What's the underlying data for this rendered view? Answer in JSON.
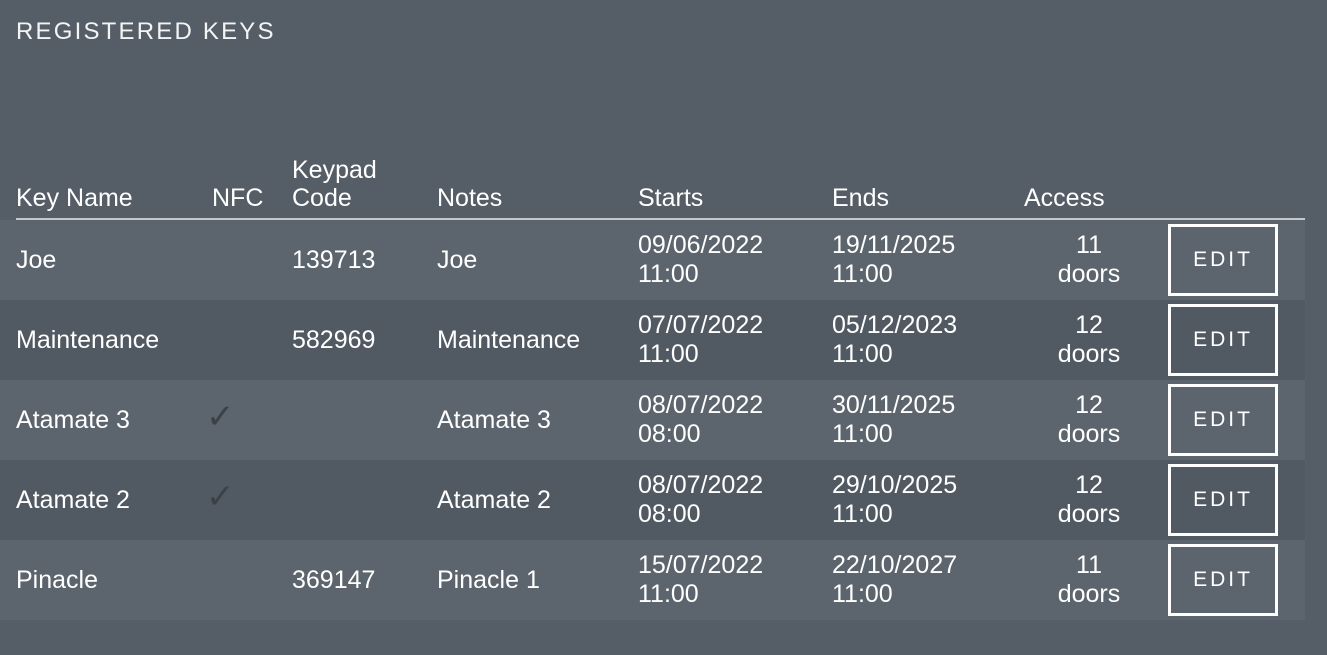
{
  "page": {
    "title": "REGISTERED KEYS",
    "background_color": "#555e66",
    "text_color": "#ffffff",
    "row_odd_color": "#5c656d",
    "row_even_color": "#515a62",
    "rule_color": "#c3c8cc",
    "check_color": "#3c4146"
  },
  "table": {
    "columns": [
      {
        "key": "key_name",
        "label": "Key Name"
      },
      {
        "key": "nfc",
        "label": "NFC"
      },
      {
        "key": "keypad_code",
        "label": "Keypad\nCode"
      },
      {
        "key": "notes",
        "label": "Notes"
      },
      {
        "key": "starts",
        "label": "Starts"
      },
      {
        "key": "ends",
        "label": "Ends"
      },
      {
        "key": "access",
        "label": "Access"
      },
      {
        "key": "actions",
        "label": ""
      }
    ],
    "rows": [
      {
        "key_name": "Joe",
        "nfc": "",
        "keypad_code": "139713",
        "notes": "Joe",
        "starts": "09/06/2022\n11:00",
        "ends": "19/11/2025\n11:00",
        "access": "11\ndoors",
        "edit_label": "EDIT"
      },
      {
        "key_name": "Maintenance",
        "nfc": "",
        "keypad_code": "582969",
        "notes": "Maintenance",
        "starts": "07/07/2022\n11:00",
        "ends": "05/12/2023\n11:00",
        "access": "12\ndoors",
        "edit_label": "EDIT"
      },
      {
        "key_name": "Atamate 3",
        "nfc": "✓",
        "keypad_code": "",
        "notes": "Atamate 3",
        "starts": "08/07/2022\n08:00",
        "ends": "30/11/2025\n11:00",
        "access": "12\ndoors",
        "edit_label": "EDIT"
      },
      {
        "key_name": "Atamate 2",
        "nfc": "✓",
        "keypad_code": "",
        "notes": "Atamate 2",
        "starts": "08/07/2022\n08:00",
        "ends": "29/10/2025\n11:00",
        "access": "12\ndoors",
        "edit_label": "EDIT"
      },
      {
        "key_name": "Pinacle",
        "nfc": "",
        "keypad_code": "369147",
        "notes": "Pinacle 1",
        "starts": "15/07/2022\n11:00",
        "ends": "22/10/2027\n11:00",
        "access": "11\ndoors",
        "edit_label": "EDIT"
      }
    ]
  }
}
